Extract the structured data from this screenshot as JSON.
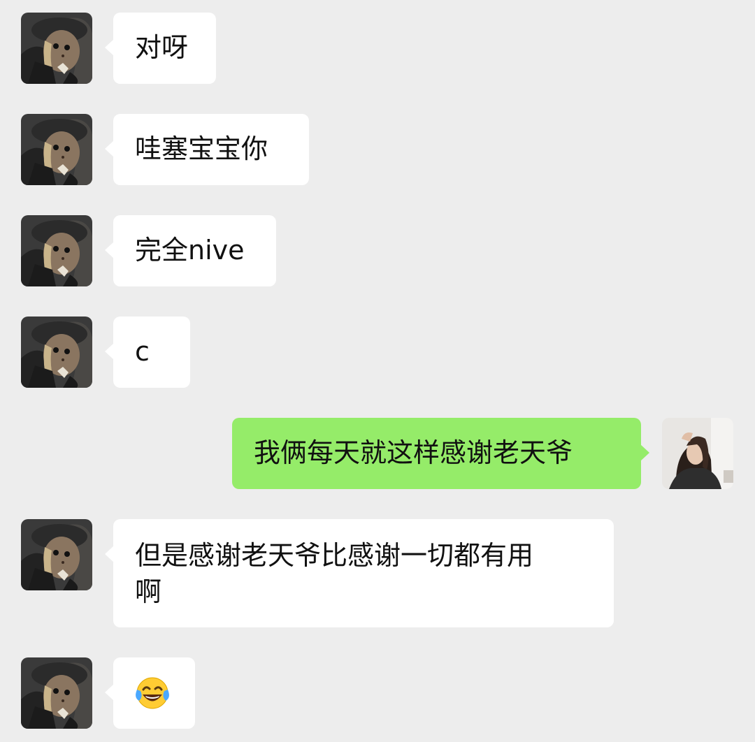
{
  "chat": {
    "messages": [
      {
        "side": "left",
        "text": "对呀"
      },
      {
        "side": "left",
        "text": "哇塞宝宝你"
      },
      {
        "side": "left",
        "text": "完全nive"
      },
      {
        "side": "left",
        "text": "c"
      },
      {
        "side": "right",
        "text": "我俩每天就这样感谢老天爷"
      },
      {
        "side": "left",
        "text_line1": "但是感谢老天爷比感谢一切都有用",
        "text_line2": "啊"
      },
      {
        "side": "left",
        "emoji": "face-with-tears-of-joy"
      }
    ]
  },
  "colors": {
    "background": "#ededed",
    "incoming_bubble": "#ffffff",
    "outgoing_bubble": "#95ec69",
    "text": "#111111"
  },
  "avatars": {
    "contact": "doll-avatar",
    "self": "woman-photo-avatar"
  }
}
